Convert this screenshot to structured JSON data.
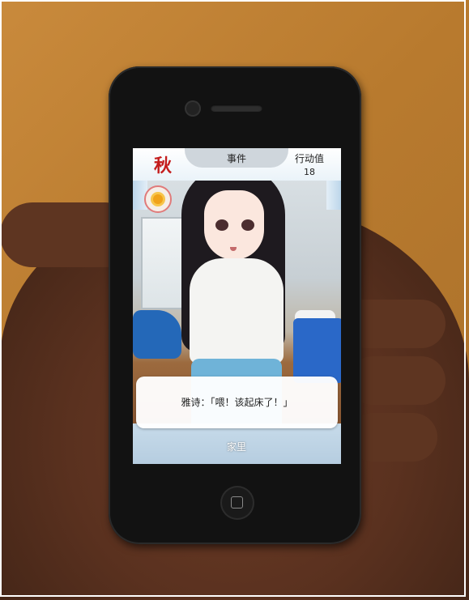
{
  "game": {
    "season": "秋",
    "events_tab": "事件",
    "action_points_label": "行动值",
    "action_points_value": "18",
    "weather_icon": "sun-icon",
    "dialog_text": "雅诗：「喂！该起床了！」",
    "location": "家里"
  },
  "colors": {
    "season_red": "#c41c1c",
    "sun_orange": "#f0a21a"
  }
}
